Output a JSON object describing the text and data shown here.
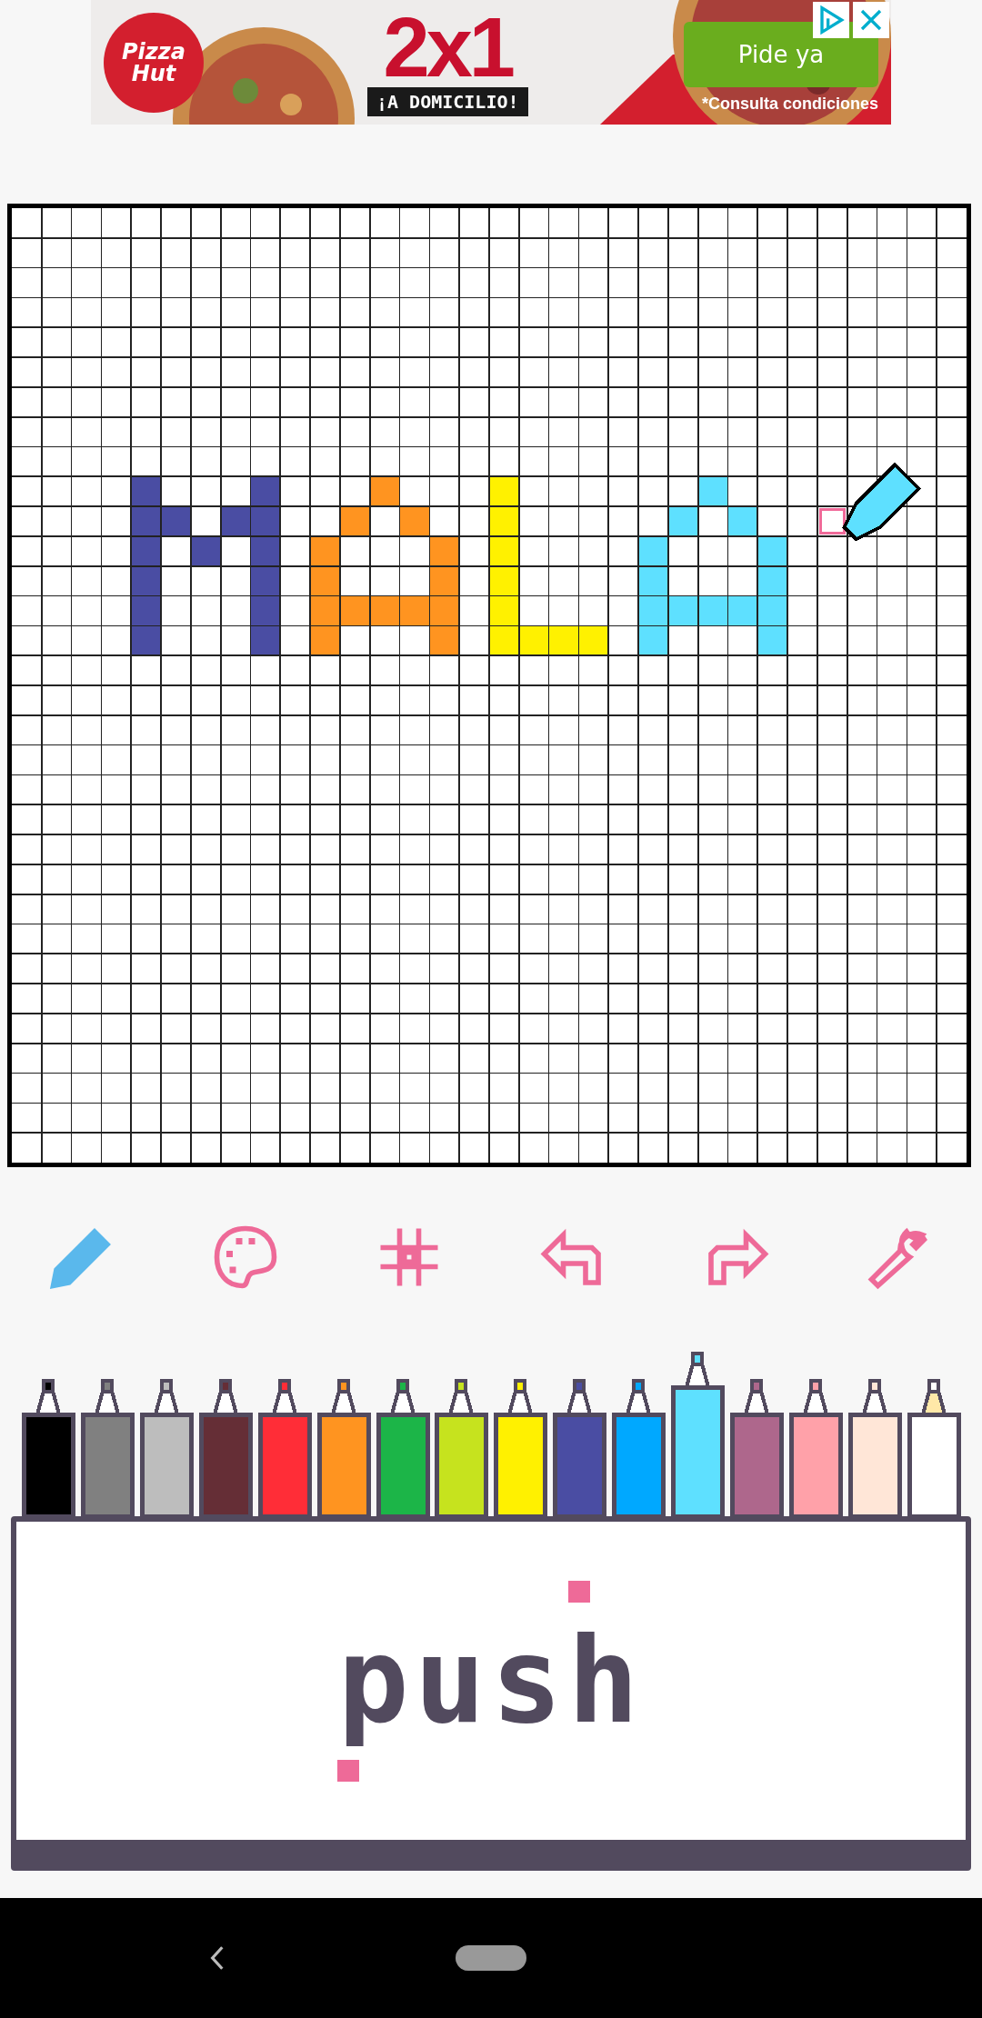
{
  "ad": {
    "logo_text": "Pizza Hut",
    "headline": "2x1",
    "tag": "¡A DOMICILIO!",
    "cta": "Pide ya",
    "note": "*Consulta condiciones"
  },
  "tools": [
    {
      "kind": "pencil",
      "selected": true
    },
    {
      "kind": "palette",
      "selected": false
    },
    {
      "kind": "grid",
      "selected": false
    },
    {
      "kind": "undo",
      "selected": false
    },
    {
      "kind": "redo",
      "selected": false
    },
    {
      "kind": "settings",
      "selected": false
    }
  ],
  "crayons": [
    {
      "color": "#000000",
      "selected": false
    },
    {
      "color": "#808080",
      "selected": false
    },
    {
      "color": "#bdbdbd",
      "selected": false
    },
    {
      "color": "#652e36",
      "selected": false
    },
    {
      "color": "#ff2d37",
      "selected": false
    },
    {
      "color": "#ff9420",
      "selected": false
    },
    {
      "color": "#1cb548",
      "selected": false
    },
    {
      "color": "#c6e31e",
      "selected": false
    },
    {
      "color": "#fff100",
      "selected": false
    },
    {
      "color": "#4a4da3",
      "selected": false
    },
    {
      "color": "#00a8ff",
      "selected": false
    },
    {
      "color": "#5ee0ff",
      "selected": true
    },
    {
      "color": "#ae678c",
      "selected": false
    },
    {
      "color": "#ffa1a9",
      "selected": false
    },
    {
      "color": "#ffe6d7",
      "selected": false
    },
    {
      "color": "#ffffff",
      "selected": false
    }
  ],
  "logo": {
    "text": "push"
  }
}
